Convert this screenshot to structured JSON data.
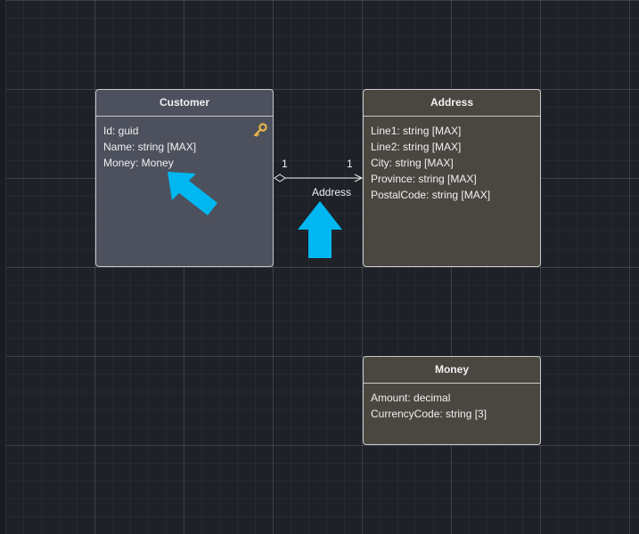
{
  "entities": {
    "customer": {
      "title": "Customer",
      "props": [
        "Id: guid",
        "Name: string [MAX]",
        "Money: Money"
      ]
    },
    "address": {
      "title": "Address",
      "props": [
        "Line1: string [MAX]",
        "Line2: string [MAX]",
        "City: string [MAX]",
        "Province: string [MAX]",
        "PostalCode: string [MAX]"
      ]
    },
    "money": {
      "title": "Money",
      "props": [
        "Amount: decimal",
        "CurrencyCode: string [3]"
      ]
    }
  },
  "relationship": {
    "label": "Address",
    "source_multiplicity": "1",
    "target_multiplicity": "1"
  },
  "icons": {
    "primary_key": "key-icon",
    "highlight_arrows": "arrow-icon"
  },
  "colors": {
    "canvas": "#1e2127",
    "customer_fill": "#4d505d",
    "valuetype_fill": "#4a4741",
    "border": "#c9c9c9",
    "key": "#e8b64a",
    "highlight_arrow": "#00b7f1"
  }
}
